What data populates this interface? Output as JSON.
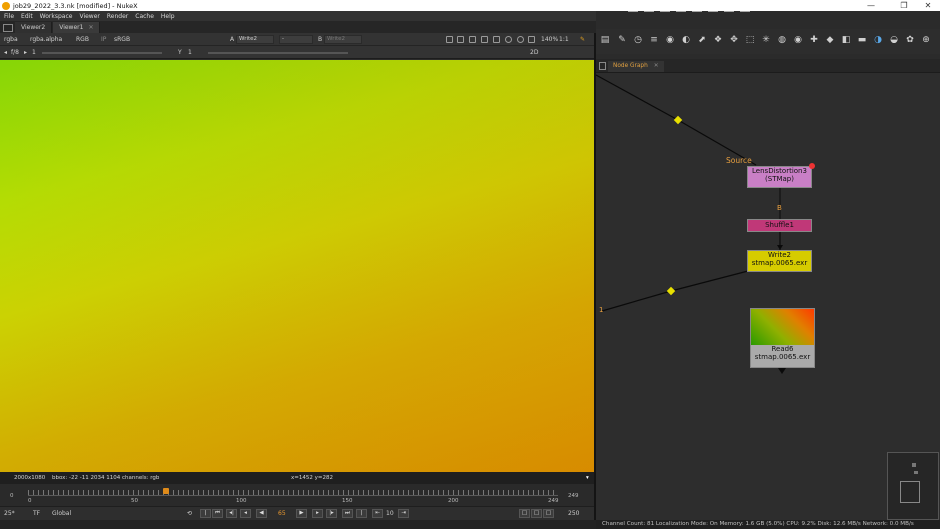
{
  "window": {
    "title": "job29_2022_3.3.nk [modified] - NukeX",
    "minimize": "—",
    "maximize": "❐",
    "close": "✕"
  },
  "menu": [
    "File",
    "Edit",
    "Workspace",
    "Viewer",
    "Render",
    "Cache",
    "Help"
  ],
  "viewer_tabs": [
    {
      "label": "Viewer2"
    },
    {
      "label": "Viewer1",
      "close": "✕"
    }
  ],
  "toolbar1": {
    "channels": "rgba",
    "alpha": "rgba.alpha",
    "colorspace": "RGB",
    "ip": "IP",
    "lut": "sRGB",
    "a_label": "A",
    "a_input": "Write2",
    "ab_op": "-",
    "b_label": "B",
    "b_input": "Write2",
    "zoom": "140%",
    "ratio": "1:1",
    "view_mode": "2D"
  },
  "toolbar2": {
    "fstop": "f/8",
    "frame_label": "1",
    "y_label": "Y",
    "y_value": "1"
  },
  "infobar": {
    "format": "2000x1080",
    "bbox": "bbox: -22 -11 2034 1104 channels: rgb",
    "coords": "x=1452 y=282"
  },
  "timeline": {
    "ticks": [
      "0",
      "50",
      "100",
      "150",
      "200",
      "249"
    ],
    "start": "0",
    "end": "249",
    "current_frame": 65
  },
  "playbar": {
    "fps": "25*",
    "tf": "TF",
    "global": "Global",
    "frame": "65",
    "step": "10",
    "end_frame": "250"
  },
  "node_graph_tab": {
    "label": "Node Graph",
    "close": "✕"
  },
  "nodes": {
    "lens": {
      "title": "LensDistortion3",
      "sub": "(STMap)",
      "label": "Source"
    },
    "shuffle": {
      "title": "Shuffle1",
      "input_b": "B"
    },
    "write": {
      "title": "Write2",
      "sub": "stmap.0065.exr"
    },
    "read": {
      "title": "Read6",
      "sub": "stmap.0065.exr"
    },
    "viewer_input": "1"
  },
  "status": "Channel Count: 81  Localization Mode: On  Memory: 1.6 GB (5.0%)  CPU: 9.2%  Disk: 12.6 MB/s  Network: 0.0 MB/s",
  "colors": {
    "lens_node": "#c97fc6",
    "shuffle_node": "#c03878",
    "write_node": "#d6cc00",
    "pipe": "#0a0a0a",
    "dot": "#e8e000"
  }
}
